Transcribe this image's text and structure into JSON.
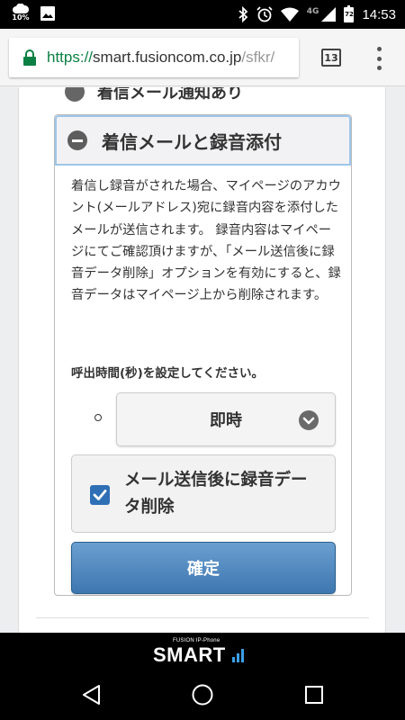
{
  "status_bar": {
    "weather_label": "10%",
    "network": "4G",
    "battery": "72",
    "time": "14:53"
  },
  "browser": {
    "url_scheme": "https://",
    "url_host": "smart.fusioncom.co.jp",
    "url_path": "/sfkr/",
    "tab_count": "13"
  },
  "content": {
    "prev_section_title": "着信メール通知あり",
    "section_title": "着信メールと録音添付",
    "description": "着信し録音がされた場合、マイページのアカウント(メールアドレス)宛に録音内容を添付したメールが送信されます。 録音内容はマイページにてご確認頂けますが、「メール送信後に録音データ削除」オプションを有効にすると、録音データはマイページ上から削除されます。",
    "prompt": "呼出時間(秒)を設定してください。",
    "select_value": "即時",
    "checkbox_label": "メール送信後に録音データ削除",
    "checkbox_checked": true,
    "confirm_label": "確定"
  },
  "footer": {
    "brand_small": "FUSION IP-Phone",
    "brand_main": "SMART"
  },
  "colors": {
    "accent": "#3e77b0",
    "header_border": "#9ec6ea",
    "url_green": "#0b8043",
    "brand_blue": "#3aa0e8"
  }
}
